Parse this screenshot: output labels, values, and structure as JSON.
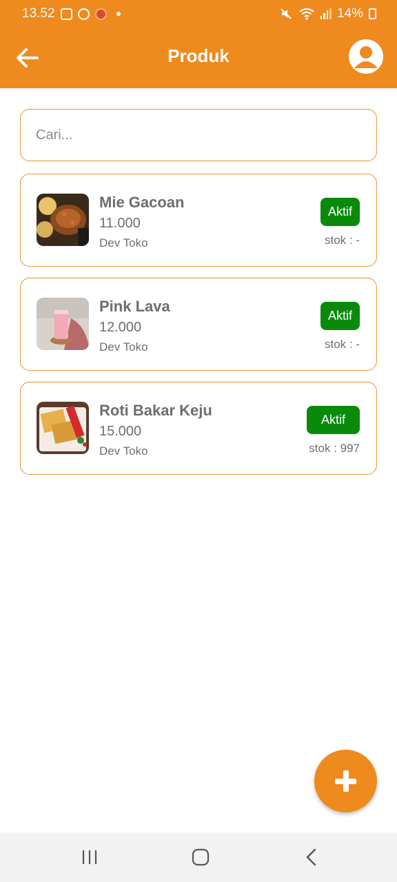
{
  "status_bar": {
    "time": "13.52",
    "battery": "14%"
  },
  "app_bar": {
    "title": "Produk",
    "back_icon": "arrow-left-icon",
    "profile_icon": "account-circle-icon"
  },
  "search": {
    "placeholder": "Cari...",
    "value": ""
  },
  "products": [
    {
      "name": "Mie Gacoan",
      "price": "11.000",
      "shop": "Dev Toko",
      "status": "Aktif",
      "stock": "stok : -"
    },
    {
      "name": "Pink Lava",
      "price": "12.000",
      "shop": "Dev Toko",
      "status": "Aktif",
      "stock": "stok : -"
    },
    {
      "name": "Roti Bakar Keju",
      "price": "15.000",
      "shop": "Dev Toko",
      "status": "Aktif",
      "stock": "stok : 997"
    }
  ],
  "fab": {
    "icon": "plus-icon"
  },
  "colors": {
    "primary": "#ef8a1e",
    "status_active": "#0a8a0a",
    "card_border": "#e4952f",
    "text_secondary": "#6d6d6d"
  }
}
